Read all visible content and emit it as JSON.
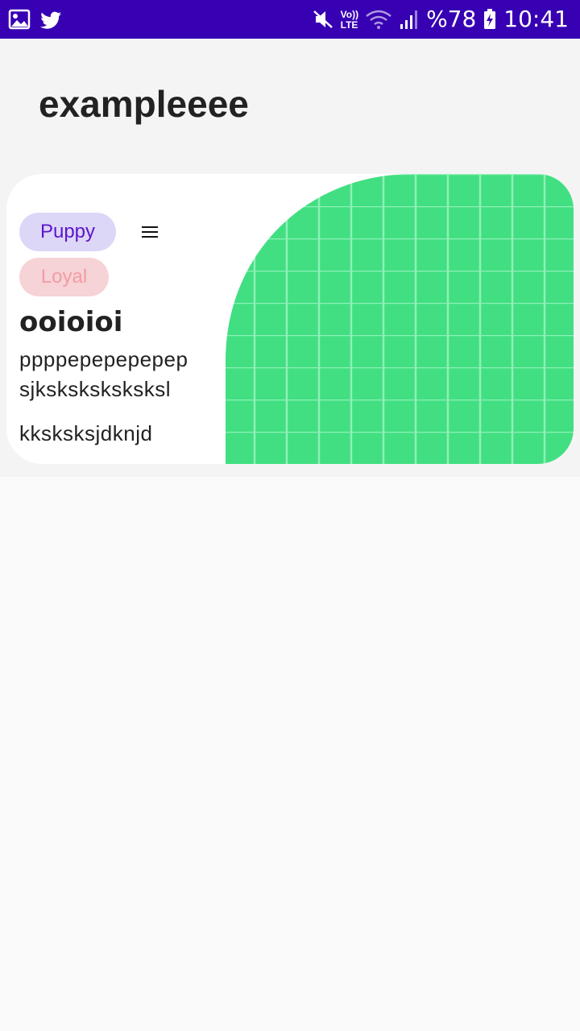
{
  "status_bar": {
    "battery": "%78",
    "time": "10:41",
    "lte_top": "Vo))",
    "lte_bottom": "LTE"
  },
  "header": {
    "title": "exampleeee"
  },
  "card": {
    "chip_primary": "Puppy",
    "chip_secondary": "Loyal",
    "title": "ooioioi",
    "body_line_1": "ppppepepepepep sjksksksksksksl",
    "body_line_2": "kksksksjdknjd",
    "image_color": "#41df82"
  }
}
